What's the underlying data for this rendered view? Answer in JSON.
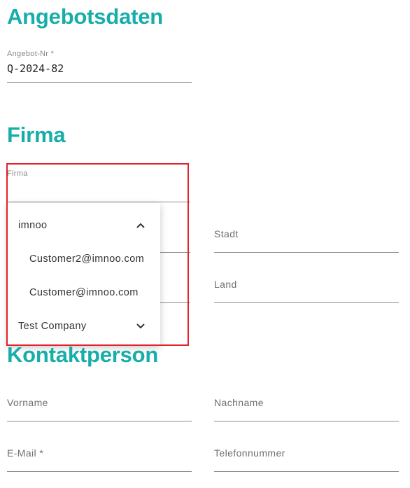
{
  "sections": {
    "offer": {
      "title": "Angebotsdaten"
    },
    "company": {
      "title": "Firma"
    },
    "contact": {
      "title": "Kontaktperson"
    }
  },
  "offer_fields": {
    "offer_number": {
      "label": "Angebot-Nr *",
      "value": "Q-2024-82"
    }
  },
  "company_fields": {
    "company": {
      "label": "Firma",
      "value": ""
    },
    "city": {
      "label": "Stadt"
    },
    "country": {
      "label": "Land"
    }
  },
  "dropdown": {
    "groups": [
      {
        "label": "imnoo",
        "expanded": true,
        "icon": "chevron-up-icon",
        "items": [
          "Customer2@imnoo.com",
          "Customer@imnoo.com"
        ]
      },
      {
        "label": "Test Company",
        "expanded": false,
        "icon": "chevron-down-icon",
        "items": []
      }
    ]
  },
  "contact_fields": {
    "first_name": {
      "label": "Vorname"
    },
    "last_name": {
      "label": "Nachname"
    },
    "email": {
      "label": "E-Mail *"
    },
    "phone": {
      "label": "Telefonnummer"
    }
  },
  "colors": {
    "accent": "#17aeaa",
    "highlight": "#e3212b",
    "underline": "#8a8a8a"
  }
}
